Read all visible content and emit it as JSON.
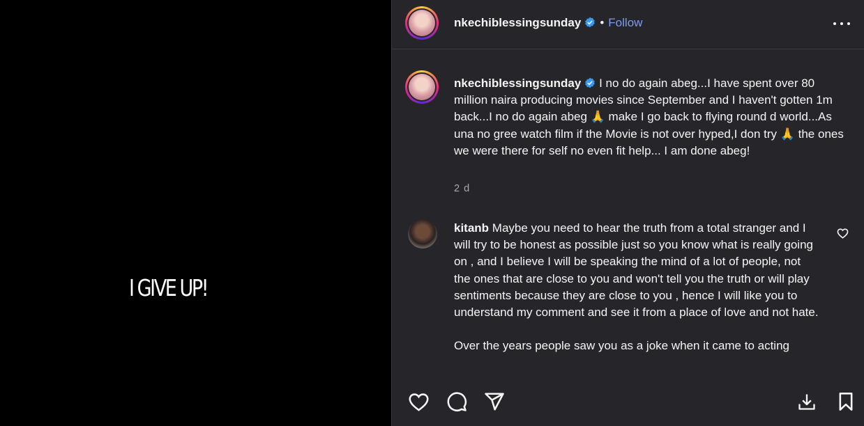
{
  "media": {
    "text": "I GIVE UP!"
  },
  "header": {
    "username": "nkechiblessingsunday",
    "separator": "•",
    "follow_label": "Follow"
  },
  "caption": {
    "username": "nkechiblessingsunday",
    "text": "I no do again abeg...I have spent over 80 million naira producing movies since September and I haven't gotten 1m back...I no do again abeg 🙏 make I go back to flying round d world...As una no gree watch film if the Movie is not over hyped,I don try 🙏 the ones we were there for self no even fit help... I am done abeg!",
    "time": "2 d"
  },
  "comment": {
    "username": "kitanb",
    "text": "Maybe you need to hear the truth from a total stranger and I will try to be honest as possible just so you know what is really going on , and I believe I will be speaking the mind of a lot of people, not the ones that are close to you and won't tell you the truth or will play sentiments because they are close to you , hence I will like you to understand my comment and see it from a place of love and not hate.",
    "text2": "Over the years people saw you as a joke when it came to acting"
  },
  "icons": {
    "like": "heart-icon",
    "comment": "comment-icon",
    "share": "send-icon",
    "download": "download-icon",
    "save": "bookmark-icon",
    "more": "more-icon",
    "verified": "verified-badge-icon"
  },
  "colors": {
    "panel_bg": "#26262a",
    "follow": "#7b9cf5",
    "verified": "#3897f0",
    "muted": "#a8a8a8"
  }
}
